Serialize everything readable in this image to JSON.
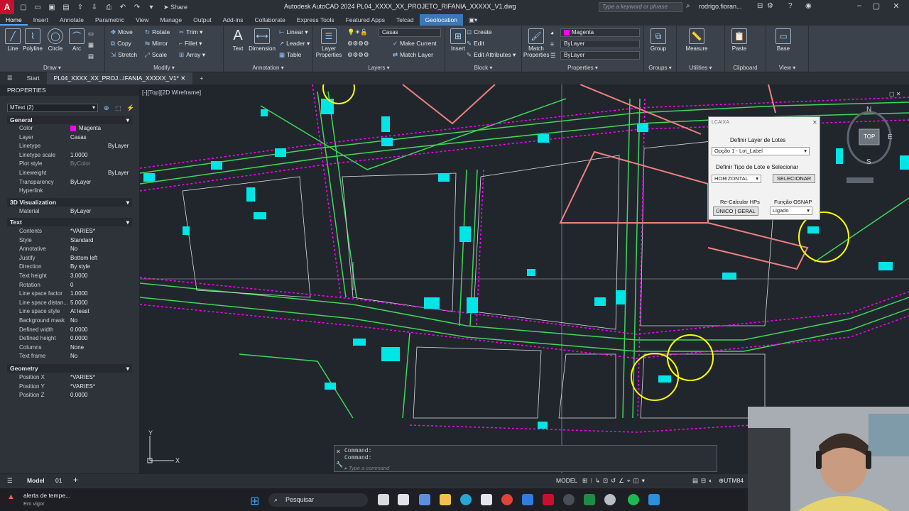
{
  "titlebar": {
    "app_letter": "A",
    "share_label": "Share",
    "window_title": "Autodesk AutoCAD 2024   PL04_XXXX_XX_PROJETO_RIFANIA_XXXXX_V1.dwg",
    "search_placeholder": "Type a keyword or phrase",
    "user_name": "rodrigo.fioran..."
  },
  "ribbon_tabs": [
    "Home",
    "Insert",
    "Annotate",
    "Parametric",
    "View",
    "Manage",
    "Output",
    "Add-ins",
    "Collaborate",
    "Express Tools",
    "Featured Apps",
    "Telcad",
    "Geolocation"
  ],
  "ribbon": {
    "draw": {
      "line": "Line",
      "polyline": "Polyline",
      "circle": "Circle",
      "arc": "Arc",
      "label": "Draw"
    },
    "modify": {
      "move": "Move",
      "rotate": "Rotate",
      "trim": "Trim",
      "copy": "Copy",
      "mirror": "Mirror",
      "fillet": "Fillet",
      "stretch": "Stretch",
      "scale": "Scale",
      "array": "Array",
      "label": "Modify"
    },
    "annotation": {
      "text": "Text",
      "dimension": "Dimension",
      "linear": "Linear",
      "leader": "Leader",
      "table": "Table",
      "label": "Annotation"
    },
    "layers": {
      "layer_properties": "Layer Properties",
      "current_layer": "Casas",
      "make_current": "Make Current",
      "match_layer": "Match Layer",
      "label": "Layers"
    },
    "block": {
      "insert": "Insert",
      "create": "Create",
      "edit": "Edit",
      "edit_attributes": "Edit Attributes",
      "label": "Block"
    },
    "properties": {
      "match": "Match Properties",
      "color": "Magenta",
      "linetype": "ByLayer",
      "lineweight": "ByLayer",
      "label": "Properties"
    },
    "groups": {
      "group": "Group",
      "label": "Groups"
    },
    "utilities": {
      "measure": "Measure",
      "label": "Utilities"
    },
    "clipboard": {
      "paste": "Paste",
      "label": "Clipboard"
    },
    "view": {
      "base": "Base",
      "label": "View"
    }
  },
  "doc_tabs": {
    "start": "Start",
    "drawing": "PL04_XXXX_XX_PROJ...IFANIA_XXXXX_V1*"
  },
  "properties_palette": {
    "title": "PROPERTIES",
    "object": "MText (2)",
    "sections": [
      {
        "name": "General",
        "rows": [
          [
            "Color",
            "Magenta"
          ],
          [
            "Layer",
            "Casas"
          ],
          [
            "Linetype",
            "ByLayer"
          ],
          [
            "Linetype scale",
            "1.0000"
          ],
          [
            "Plot style",
            "ByColor"
          ],
          [
            "Lineweight",
            "ByLayer"
          ],
          [
            "Transparency",
            "ByLayer"
          ],
          [
            "Hyperlink",
            ""
          ]
        ]
      },
      {
        "name": "3D Visualization",
        "rows": [
          [
            "Material",
            "ByLayer"
          ]
        ]
      },
      {
        "name": "Text",
        "rows": [
          [
            "Contents",
            "*VARIES*"
          ],
          [
            "Style",
            "Standard"
          ],
          [
            "Annotative",
            "No"
          ],
          [
            "Justify",
            "Bottom left"
          ],
          [
            "Direction",
            "By style"
          ],
          [
            "Text height",
            "3.0000"
          ],
          [
            "Rotation",
            "0"
          ],
          [
            "Line space factor",
            "1.0000"
          ],
          [
            "Line space distan...",
            "5.0000"
          ],
          [
            "Line space style",
            "At least"
          ],
          [
            "Background mask",
            "No"
          ],
          [
            "Defined width",
            "0.0000"
          ],
          [
            "Defined height",
            "0.0000"
          ],
          [
            "Columns",
            "None"
          ],
          [
            "Text frame",
            "No"
          ]
        ]
      },
      {
        "name": "Geometry",
        "rows": [
          [
            "Position X",
            "*VARIES*"
          ],
          [
            "Position Y",
            "*VARIES*"
          ],
          [
            "Position Z",
            "0.0000"
          ]
        ]
      }
    ]
  },
  "viewport": {
    "label": "[-][Top][2D Wireframe]"
  },
  "lcaixa": {
    "title": "LCAIXA",
    "define_layer": "Definir Layer de Lotes",
    "layer_option": "Opção 1 - Lot_Label",
    "define_type": "Definir Tipo de Lote e Selecionar",
    "type_option": "HORIZONTAL",
    "select_btn": "SELECIONAR",
    "recalc_label": "Re-Calcular HPs",
    "recalc_btn": "ÚNICO | GERAL",
    "osnap_label": "Função OSNAP",
    "osnap_option": "Ligado"
  },
  "viewcube": {
    "north": "N",
    "south": "S",
    "east": "E",
    "top": "TOP"
  },
  "command": {
    "line1": "Command:",
    "line2": "Command:",
    "placeholder": "Type a command"
  },
  "statusbar": {
    "model_tab": "Model",
    "layout_tab": "01",
    "model_label": "MODEL",
    "coord_sys": "UTM84"
  },
  "taskbar": {
    "notify_title": "alerta de tempe...",
    "notify_sub": "Em vigor",
    "search": "Pesquisar"
  },
  "colors": {
    "magenta": "#ff00ff",
    "cyan": "#00e5e5",
    "green": "#3fd65a",
    "pink": "#f08080",
    "yellow": "#ffff00",
    "accent": "#3c78b8"
  }
}
